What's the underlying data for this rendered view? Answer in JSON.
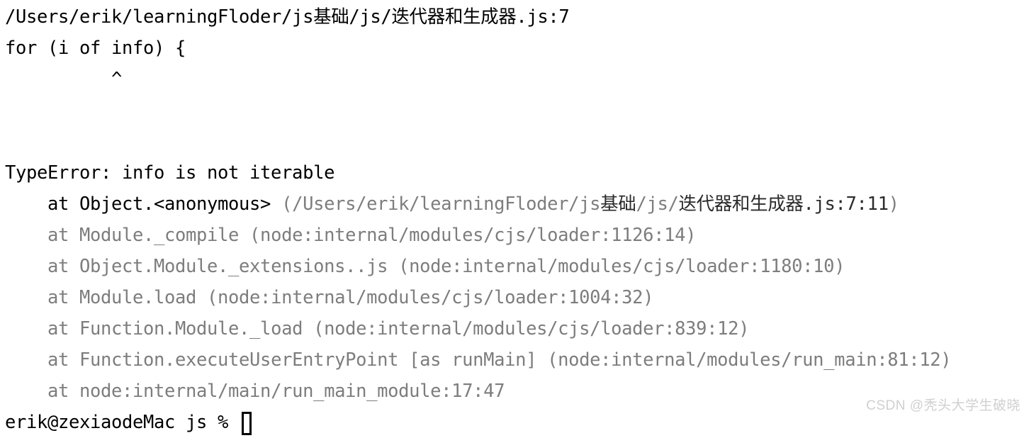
{
  "terminal": {
    "background_color": "#ffffff",
    "foreground_color": "#000000",
    "dim_color": "#7d7d7d",
    "error_header_path": "/Users/erik/learningFloder/js基础/js/迭代器和生成器.js:7",
    "source_line": "for (i of info) {",
    "caret_line": "          ^",
    "blank_line_1": "",
    "blank_line_2": "",
    "error_message": "TypeError: info is not iterable",
    "stack": [
      {
        "indent": "    ",
        "fn": "at Object.<anonymous> ",
        "loc_open": "(/Users/erik/learningFloder/js",
        "loc_cjk": "基础",
        "loc_mid": "/js/",
        "loc_cjk2": "迭代器和生成器",
        "loc_end": ".js:7:11",
        "loc_close": ")",
        "dim": false
      },
      {
        "indent": "    ",
        "text": "at Module._compile (node:internal/modules/cjs/loader:1126:14)",
        "dim": true
      },
      {
        "indent": "    ",
        "text": "at Object.Module._extensions..js (node:internal/modules/cjs/loader:1180:10)",
        "dim": true
      },
      {
        "indent": "    ",
        "text": "at Module.load (node:internal/modules/cjs/loader:1004:32)",
        "dim": true
      },
      {
        "indent": "    ",
        "text": "at Function.Module._load (node:internal/modules/cjs/loader:839:12)",
        "dim": true
      },
      {
        "indent": "    ",
        "text": "at Function.executeUserEntryPoint [as runMain] (node:internal/modules/run_main:81:12)",
        "dim": true
      },
      {
        "indent": "    ",
        "text": "at node:internal/main/run_main_module:17:47",
        "dim": true
      }
    ],
    "prompt": "erik@zexiaodeMac js % ",
    "cursor_style": "hollow-block"
  },
  "watermark": {
    "text": "CSDN @秃头大学生破晓",
    "color": "#d0d0d0"
  }
}
